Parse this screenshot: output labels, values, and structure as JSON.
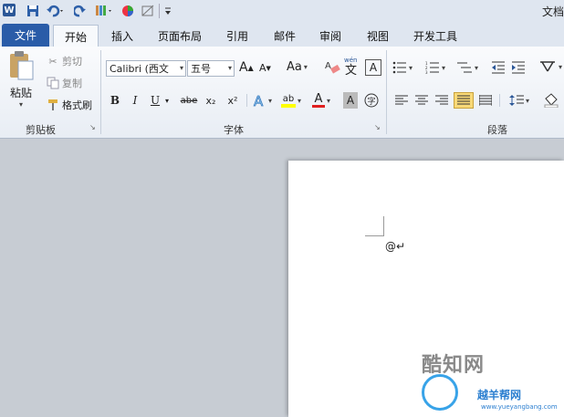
{
  "window": {
    "title": "文档"
  },
  "tabs": [
    {
      "label": "文件",
      "kind": "file"
    },
    {
      "label": "开始",
      "kind": "active"
    },
    {
      "label": "插入"
    },
    {
      "label": "页面布局"
    },
    {
      "label": "引用"
    },
    {
      "label": "邮件"
    },
    {
      "label": "审阅"
    },
    {
      "label": "视图"
    },
    {
      "label": "开发工具"
    }
  ],
  "clipboard": {
    "paste": "粘贴",
    "cut": "剪切",
    "copy": "复制",
    "format_painter": "格式刷",
    "group_label": "剪贴板"
  },
  "font": {
    "font_name": "Calibri (西文",
    "font_size": "五号",
    "bold": "B",
    "italic": "I",
    "underline": "U",
    "strike": "abe",
    "subscript": "x₂",
    "superscript": "x²",
    "change_case": "Aa",
    "grow": "A",
    "shrink": "A",
    "font_color_letter": "A",
    "highlight_label": "ab",
    "group_label": "字体"
  },
  "paragraph": {
    "group_label": "段落"
  },
  "document": {
    "text": "@↵"
  },
  "watermark": {
    "brand": "酷知网",
    "site": "越羊帮网",
    "url": "www.yueyangbang.com"
  },
  "colors": {
    "file_tab": "#2a5ca8",
    "highlight": "#ffff00",
    "font_color": "#e02020",
    "accent": "#2c7fd0"
  }
}
